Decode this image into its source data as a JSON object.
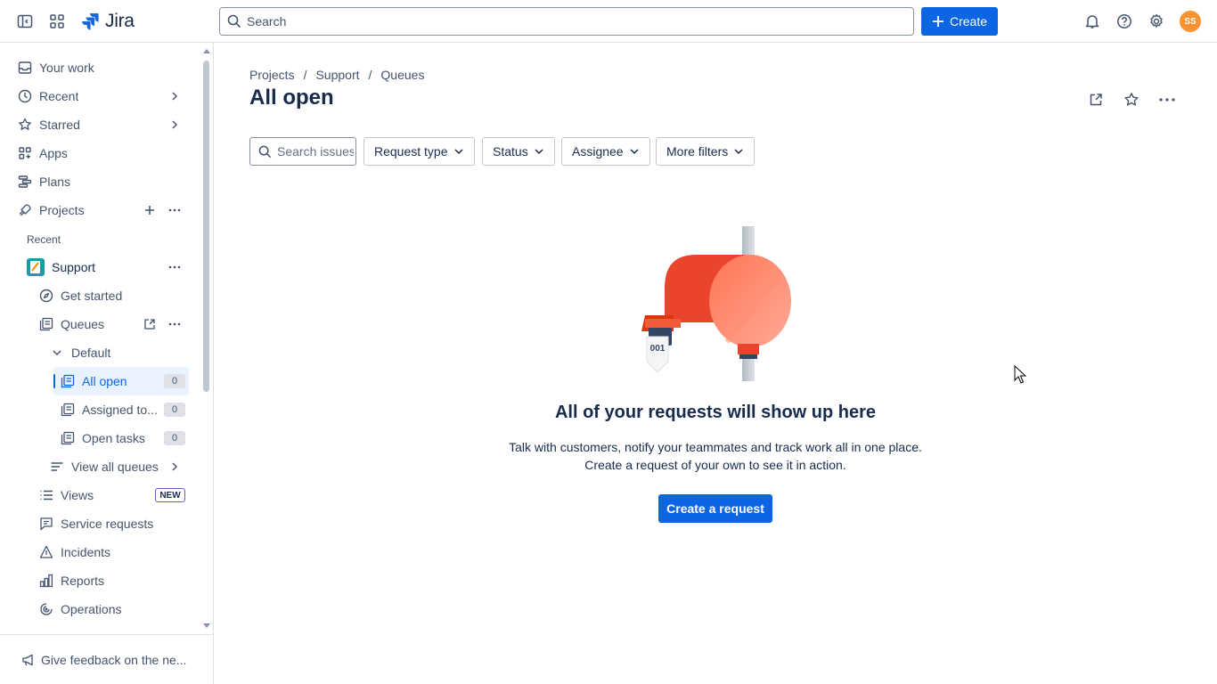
{
  "topbar": {
    "app_name": "Jira",
    "search_placeholder": "Search",
    "create_label": "Create",
    "avatar_initials": "SS"
  },
  "sidebar": {
    "nav": {
      "your_work": "Your work",
      "recent": "Recent",
      "starred": "Starred",
      "apps": "Apps",
      "plans": "Plans",
      "projects": "Projects"
    },
    "section_recent": "Recent",
    "project": {
      "name": "Support",
      "get_started": "Get started",
      "queues": "Queues",
      "default_group": "Default",
      "queue_items": [
        {
          "label": "All open",
          "count": "0"
        },
        {
          "label": "Assigned to...",
          "count": "0"
        },
        {
          "label": "Open tasks",
          "count": "0"
        }
      ],
      "view_all_queues": "View all queues",
      "views": "Views",
      "views_badge": "NEW",
      "service_requests": "Service requests",
      "incidents": "Incidents",
      "reports": "Reports",
      "operations": "Operations"
    },
    "feedback": "Give feedback on the ne..."
  },
  "main": {
    "breadcrumb": [
      "Projects",
      "/",
      "Support",
      "/",
      "Queues"
    ],
    "title": "All open",
    "filters": {
      "search_placeholder": "Search issues",
      "request_type": "Request type",
      "status": "Status",
      "assignee": "Assignee",
      "more_filters": "More filters"
    },
    "empty_state": {
      "ticket_number": "001",
      "title": "All of your requests will show up here",
      "line1": "Talk with customers, notify your teammates and track work all in one place.",
      "line2": "Create a request of your own to see it in action.",
      "cta": "Create a request"
    }
  },
  "colors": {
    "brand_blue": "#0c66e4",
    "avatar": "#f79232",
    "illustration_red": "#f15a36"
  }
}
